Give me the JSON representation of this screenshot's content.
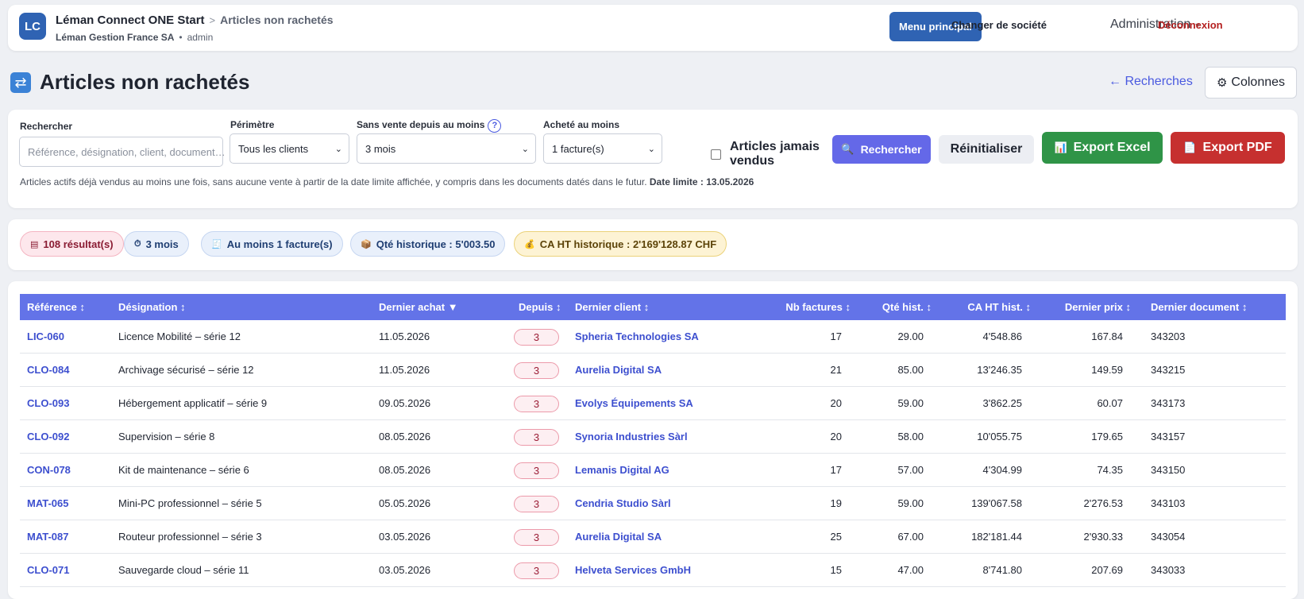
{
  "header": {
    "logo": "LC",
    "app_name": "Léman Connect ONE Start",
    "crumb_sep": ">",
    "crumb": "Articles non rachetés",
    "company": "Léman Gestion France SA",
    "dot": "•",
    "user": "admin",
    "menu_label": "Menu principal",
    "change_company": "Changer de société",
    "administration": "Administration",
    "logout": "Déconnexion"
  },
  "page": {
    "title": "Articles non rachetés",
    "back_link": "← Recherches",
    "columns_button": "Colonnes"
  },
  "filters": {
    "search_label": "Rechercher",
    "search_placeholder": "Référence, désignation, client, document…",
    "perimeter_label": "Périmètre",
    "perimeter_value": "Tous les clients",
    "since_label": "Sans vente depuis au moins",
    "since_help": "?",
    "since_value": "3 mois",
    "bought_label": "Acheté au moins",
    "bought_value": "1 facture(s)",
    "never_sold_label_1": "Articles jamais",
    "never_sold_label_2": "vendus",
    "search_button": "Rechercher",
    "reset_button": "Réinitialiser",
    "excel_button": "Export Excel",
    "pdf_button": "Export PDF",
    "note": "Articles actifs déjà vendus au moins une fois, sans aucune vente à partir de la date limite affichée, y compris dans les documents datés dans le futur.",
    "date_limit": "Date limite : 13.05.2026"
  },
  "chips": {
    "results": "108 résultat(s)",
    "period": "3 mois",
    "invoices": "Au moins 1 facture(s)",
    "qty": "Qté historique : 5'003.50",
    "revenue": "CA HT historique : 2'169'128.87 CHF"
  },
  "table": {
    "headers": {
      "ref": "Référence ↕",
      "designation": "Désignation ↕",
      "last_purchase": "Dernier achat ▼",
      "since": "Depuis ↕",
      "last_client": "Dernier client ↕",
      "nb_invoices": "Nb factures ↕",
      "qty": "Qté hist. ↕",
      "revenue": "CA HT hist. ↕",
      "last_price": "Dernier prix ↕",
      "last_doc": "Dernier document ↕"
    },
    "rows": [
      {
        "ref": "LIC-060",
        "designation": "Licence Mobilité – série 12",
        "date": "11.05.2026",
        "since": "3",
        "client": "Spheria Technologies SA",
        "nb": "17",
        "qty": "29.00",
        "revenue": "4'548.86",
        "price": "167.84",
        "doc": "343203"
      },
      {
        "ref": "CLO-084",
        "designation": "Archivage sécurisé – série 12",
        "date": "11.05.2026",
        "since": "3",
        "client": "Aurelia Digital SA",
        "nb": "21",
        "qty": "85.00",
        "revenue": "13'246.35",
        "price": "149.59",
        "doc": "343215"
      },
      {
        "ref": "CLO-093",
        "designation": "Hébergement applicatif – série 9",
        "date": "09.05.2026",
        "since": "3",
        "client": "Evolys Équipements SA",
        "nb": "20",
        "qty": "59.00",
        "revenue": "3'862.25",
        "price": "60.07",
        "doc": "343173"
      },
      {
        "ref": "CLO-092",
        "designation": "Supervision – série 8",
        "date": "08.05.2026",
        "since": "3",
        "client": "Synoria Industries Sàrl",
        "nb": "20",
        "qty": "58.00",
        "revenue": "10'055.75",
        "price": "179.65",
        "doc": "343157"
      },
      {
        "ref": "CON-078",
        "designation": "Kit de maintenance – série 6",
        "date": "08.05.2026",
        "since": "3",
        "client": "Lemanis Digital AG",
        "nb": "17",
        "qty": "57.00",
        "revenue": "4'304.99",
        "price": "74.35",
        "doc": "343150"
      },
      {
        "ref": "MAT-065",
        "designation": "Mini-PC professionnel – série 5",
        "date": "05.05.2026",
        "since": "3",
        "client": "Cendria Studio Sàrl",
        "nb": "19",
        "qty": "59.00",
        "revenue": "139'067.58",
        "price": "2'276.53",
        "doc": "343103"
      },
      {
        "ref": "MAT-087",
        "designation": "Routeur professionnel – série 3",
        "date": "03.05.2026",
        "since": "3",
        "client": "Aurelia Digital SA",
        "nb": "25",
        "qty": "67.00",
        "revenue": "182'181.44",
        "price": "2'930.33",
        "doc": "343054"
      },
      {
        "ref": "CLO-071",
        "designation": "Sauvegarde cloud – série 11",
        "date": "03.05.2026",
        "since": "3",
        "client": "Helveta Services GmbH",
        "nb": "15",
        "qty": "47.00",
        "revenue": "8'741.80",
        "price": "207.69",
        "doc": "343033"
      }
    ]
  }
}
